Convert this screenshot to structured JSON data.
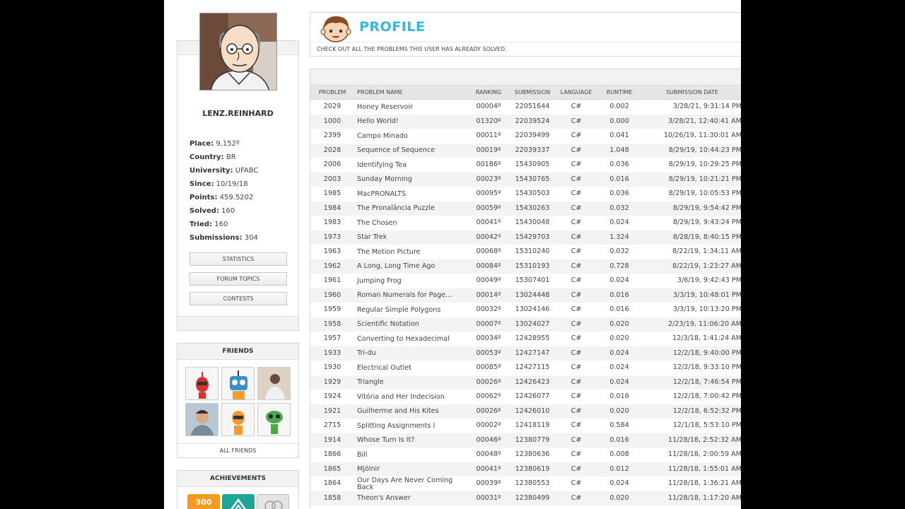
{
  "user": {
    "name": "LENZ.REINHARD",
    "info": [
      {
        "label": "Place:",
        "value": "9,152º"
      },
      {
        "label": "Country:",
        "value": "BR"
      },
      {
        "label": "University:",
        "value": "UFABC"
      },
      {
        "label": "Since:",
        "value": "10/19/18"
      },
      {
        "label": "Points:",
        "value": "459.5202"
      },
      {
        "label": "Solved:",
        "value": "160"
      },
      {
        "label": "Tried:",
        "value": "160"
      },
      {
        "label": "Submissions:",
        "value": "304"
      }
    ],
    "buttons": [
      "STATISTICS",
      "FORUM TOPICS",
      "CONTESTS"
    ]
  },
  "friends": {
    "title": "FRIENDS",
    "all_label": "ALL FRIENDS"
  },
  "achievements": {
    "title": "ACHIEVEMENTS",
    "first_badge": "300"
  },
  "header": {
    "title": "PROFILE",
    "subtitle": "CHECK OUT ALL THE PROBLEMS THIS USER HAS ALREADY SOLVED."
  },
  "table": {
    "columns": [
      "PROBLEM",
      "PROBLEM NAME",
      "RANKING",
      "SUBMISSION",
      "LANGUAGE",
      "RUNTIME",
      "SUBMISSION DATE"
    ],
    "rows": [
      [
        "2029",
        "Honey Reservoir",
        "00004º",
        "22051644",
        "C#",
        "0.002",
        "3/28/21, 9:31:14 PM"
      ],
      [
        "1000",
        "Hello World!",
        "01320º",
        "22039524",
        "C#",
        "0.000",
        "3/28/21, 12:40:41 AM"
      ],
      [
        "2399",
        "Campo Minado",
        "00011º",
        "22039499",
        "C#",
        "0.041",
        "10/26/19, 11:30:01 AM"
      ],
      [
        "2028",
        "Sequence of Sequence",
        "00019º",
        "22039337",
        "C#",
        "1.048",
        "8/29/19, 10:44:23 PM"
      ],
      [
        "2006",
        "Identifying Tea",
        "00186º",
        "15430905",
        "C#",
        "0.036",
        "8/29/19, 10:29:25 PM"
      ],
      [
        "2003",
        "Sunday Morning",
        "00023º",
        "15430765",
        "C#",
        "0.016",
        "8/29/19, 10:21:21 PM"
      ],
      [
        "1985",
        "MacPRONALTS",
        "00095º",
        "15430503",
        "C#",
        "0.036",
        "8/29/19, 10:05:53 PM"
      ],
      [
        "1984",
        "The Pronalância Puzzle",
        "00059º",
        "15430263",
        "C#",
        "0.032",
        "8/29/19, 9:54:42 PM"
      ],
      [
        "1983",
        "The Chosen",
        "00041º",
        "15430048",
        "C#",
        "0.024",
        "8/29/19, 9:43:24 PM"
      ],
      [
        "1973",
        "Star Trek",
        "00042º",
        "15429703",
        "C#",
        "1.324",
        "8/28/19, 8:40:15 PM"
      ],
      [
        "1963",
        "The Motion Picture",
        "00068º",
        "15310240",
        "C#",
        "0.032",
        "8/22/19, 1:34:11 AM"
      ],
      [
        "1962",
        "A Long, Long Time Ago",
        "00084º",
        "15310193",
        "C#",
        "0.728",
        "8/22/19, 1:23:27 AM"
      ],
      [
        "1961",
        "Jumping Frog",
        "00049º",
        "15307401",
        "C#",
        "0.024",
        "3/6/19, 9:42:43 PM"
      ],
      [
        "1960",
        "Roman Numerals for Page...",
        "00014º",
        "13024448",
        "C#",
        "0.016",
        "3/3/19, 10:48:01 PM"
      ],
      [
        "1959",
        "Regular Simple Polygons",
        "00032º",
        "13024146",
        "C#",
        "0.016",
        "3/3/19, 10:13:20 PM"
      ],
      [
        "1958",
        "Scientific Notation",
        "00007º",
        "13024027",
        "C#",
        "0.020",
        "2/23/19, 11:06:20 AM"
      ],
      [
        "1957",
        "Converting to Hexadecimal",
        "00034º",
        "12428955",
        "C#",
        "0.020",
        "12/3/18, 1:41:24 AM"
      ],
      [
        "1933",
        "Tri-du",
        "00053º",
        "12427147",
        "C#",
        "0.024",
        "12/2/18, 9:40:00 PM"
      ],
      [
        "1930",
        "Electrical Outlet",
        "00085º",
        "12427115",
        "C#",
        "0.024",
        "12/2/18, 9:33:10 PM"
      ],
      [
        "1929",
        "Triangle",
        "00026º",
        "12426423",
        "C#",
        "0.024",
        "12/2/18, 7:46:54 PM"
      ],
      [
        "1924",
        "Vitória and Her Indecision",
        "00062º",
        "12426077",
        "C#",
        "0.016",
        "12/2/18, 7:00:42 PM"
      ],
      [
        "1921",
        "Guilherme and His Kites",
        "00026º",
        "12426010",
        "C#",
        "0.020",
        "12/2/18, 6:52:32 PM"
      ],
      [
        "2715",
        "Splitting Assignments I",
        "00002º",
        "12418119",
        "C#",
        "0.584",
        "12/1/18, 5:53:10 PM"
      ],
      [
        "1914",
        "Whose Turn Is It?",
        "00046º",
        "12380779",
        "C#",
        "0.016",
        "11/28/18, 2:52:32 AM"
      ],
      [
        "1866",
        "Bill",
        "00048º",
        "12380636",
        "C#",
        "0.008",
        "11/28/18, 2:00:59 AM"
      ],
      [
        "1865",
        "Mjölnir",
        "00041º",
        "12380619",
        "C#",
        "0.012",
        "11/28/18, 1:55:01 AM"
      ],
      [
        "1864",
        "Our Days Are Never Coming Back",
        "00039º",
        "12380553",
        "C#",
        "0.024",
        "11/28/18, 1:36:21 AM"
      ],
      [
        "1858",
        "Theon's Answer",
        "00031º",
        "12380499",
        "C#",
        "0.020",
        "11/28/18, 1:17:20 AM"
      ]
    ]
  },
  "colors": {
    "accent": "#35b9d6",
    "badge_orange": "#f39a1f",
    "badge_teal": "#1fa595"
  }
}
